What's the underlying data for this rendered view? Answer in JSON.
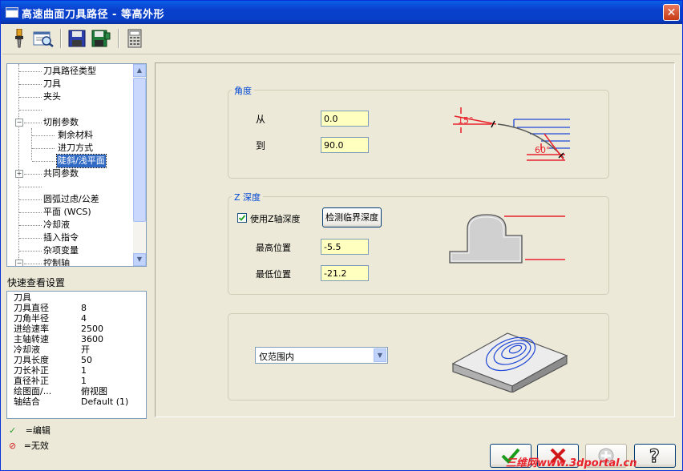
{
  "window": {
    "title": "高速曲面刀具路径 - 等高外形",
    "close_glyph": "✕"
  },
  "toolbar": {
    "icons": [
      "tool-icon",
      "preview-icon",
      "save-icon",
      "save-all-icon",
      "calculator-icon"
    ]
  },
  "tree": {
    "items": [
      {
        "label": "刀具路径类型",
        "level": 1
      },
      {
        "label": "刀具",
        "level": 1
      },
      {
        "label": "夹头",
        "level": 1
      },
      {
        "label": "",
        "level": 1
      },
      {
        "label": "切削参数",
        "level": 0,
        "expander": "−"
      },
      {
        "label": "剩余材料",
        "level": 2
      },
      {
        "label": "进刀方式",
        "level": 2
      },
      {
        "label": "陡斜/浅平面",
        "level": 2,
        "selected": true
      },
      {
        "label": "共同参数",
        "level": 0,
        "expander": "+"
      },
      {
        "label": "",
        "level": 1
      },
      {
        "label": "圆弧过虑/公差",
        "level": 1
      },
      {
        "label": "平面 (WCS)",
        "level": 1
      },
      {
        "label": "冷却液",
        "level": 1
      },
      {
        "label": "插入指令",
        "level": 1
      },
      {
        "label": "杂项变量",
        "level": 1
      },
      {
        "label": "控制轴",
        "level": 0,
        "expander": "−"
      }
    ]
  },
  "quick_settings": {
    "label": "快速查看设置",
    "rows": [
      {
        "k": "刀具",
        "v": ""
      },
      {
        "k": "刀具直径",
        "v": "8"
      },
      {
        "k": "刀角半径",
        "v": "4"
      },
      {
        "k": "进给速率",
        "v": "2500"
      },
      {
        "k": "主轴转速",
        "v": "3600"
      },
      {
        "k": "冷却液",
        "v": "开"
      },
      {
        "k": "刀具长度",
        "v": "50"
      },
      {
        "k": "刀长补正",
        "v": "1"
      },
      {
        "k": "直径补正",
        "v": "1"
      },
      {
        "k": "绘图面/...",
        "v": "俯视图"
      },
      {
        "k": "轴结合",
        "v": "Default (1)"
      }
    ]
  },
  "legend": {
    "edit": "=编辑",
    "invalid": "=无效"
  },
  "angle": {
    "group_label": "角度",
    "from_label": "从",
    "from_value": "0.0",
    "to_label": "到",
    "to_value": "90.0",
    "diagram": {
      "small_angle": "15°",
      "large_angle": "60°"
    }
  },
  "zdepth": {
    "group_label": "Z 深度",
    "use_z_label": "使用Z轴深度",
    "use_z_checked": true,
    "detect_button": "检测临界深度",
    "max_label": "最高位置",
    "max_value": "-5.5",
    "min_label": "最低位置",
    "min_value": "-21.2"
  },
  "range": {
    "selected": "仅范围内"
  },
  "colors": {
    "accent_red": "#e8212b",
    "diagram_blue": "#1f47d6",
    "input_bg": "#ffffc0"
  },
  "watermark": "三维网www.3dportal.cn"
}
